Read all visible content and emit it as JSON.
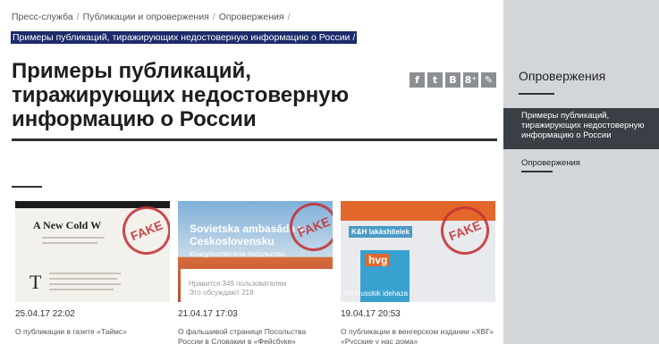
{
  "breadcrumb": {
    "items": [
      "Пресс-служба",
      "Публикации и опровержения",
      "Опровержения"
    ],
    "current": "Примеры публикаций, тиражирующих недостоверную информацию о России /"
  },
  "page": {
    "title": "Примеры публикаций, тиражирующих недостоверную информацию о России"
  },
  "share": {
    "icons": [
      "facebook-icon",
      "twitter-icon",
      "vkontakte-icon",
      "google-plus-icon",
      "livejournal-icon"
    ],
    "labels": [
      "f",
      "t",
      "B",
      "8⁺",
      "✎"
    ]
  },
  "cards": [
    {
      "date": "25.04.17 22:02",
      "caption": "О публикации в газете «Таймс»",
      "thumb": {
        "headline": "A New Cold W",
        "stamp": "FAKE"
      }
    },
    {
      "date": "21.04.17 17:03",
      "caption": "О фальшивой странице Посольства России в Словакии в «Фейсбуке»",
      "thumb": {
        "title": "Sovietska ambasáda v Ceskoslovensku",
        "subtitle": "Консульство или посольство",
        "likes": "Нравится 349 пользователям",
        "discussing": "Это обсуждают 218",
        "stamp": "FAKE"
      }
    },
    {
      "date": "19.04.17 20:53",
      "caption": "О публикации в венгерском издании «ХВГ» «Русские у нас дома»",
      "thumb": {
        "brand": "K&H lakáshitelek",
        "logo": "hvg",
        "tag": "YG Russkik idehaza",
        "stamp": "FAKE"
      }
    }
  ],
  "sidebar": {
    "title": "Опровержения",
    "active_item": "Примеры публикаций, тиражирующих недостоверную информацию о России",
    "link": "Опровержения"
  },
  "colors": {
    "sidebar_bg": "#d3d6d9",
    "active_bg": "#3a3f45",
    "highlight": "#1c2b6b",
    "stamp": "#c43236"
  }
}
